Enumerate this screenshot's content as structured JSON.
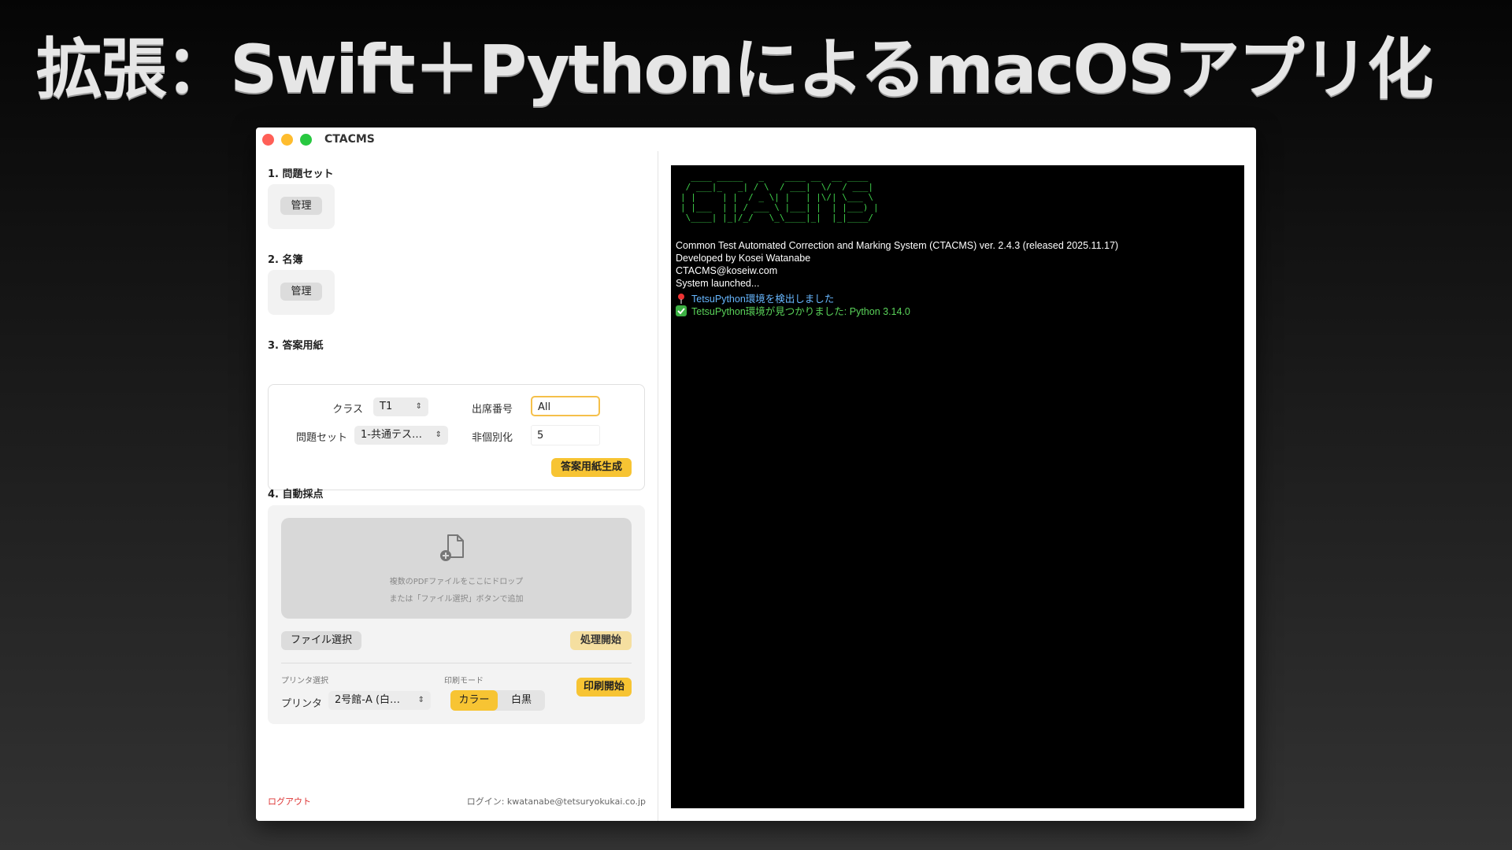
{
  "slide": {
    "title": "拡張：Swift＋PythonによるmacOSアプリ化"
  },
  "window": {
    "title": "CTACMS"
  },
  "section1": {
    "label": "1. 問題セット",
    "manage_button": "管理"
  },
  "section2": {
    "label": "2. 名簿",
    "manage_button": "管理"
  },
  "section3": {
    "label": "3. 答案用紙",
    "class_label": "クラス",
    "class_value": "T1",
    "problemset_label": "問題セット",
    "problemset_value": "1-共通テス…",
    "attendance_label": "出席番号",
    "attendance_value": "All",
    "anonymize_label": "非個別化",
    "anonymize_value": "5",
    "generate_button": "答案用紙生成"
  },
  "section4": {
    "label": "4. 自動採点",
    "drop_line1": "複数のPDFファイルをここにドロップ",
    "drop_line2": "または「ファイル選択」ボタンで追加",
    "file_select_button": "ファイル選択",
    "process_button": "処理開始",
    "printer_section_label": "プリンタ選択",
    "printer_label": "プリンタ",
    "printer_value": "2号館-A (白…",
    "print_mode_label": "印刷モード",
    "mode_color": "カラー",
    "mode_mono": "白黒",
    "print_button": "印刷開始"
  },
  "footer": {
    "logout": "ログアウト",
    "login": "ログイン: kwatanabe@tetsuryokukai.co.jp"
  },
  "terminal": {
    "ascii_art": "  ____ _____   _    ____ __  __ ____\n / ___|_   _| / \\  / ___|  \\/  / ___|\n| |     | |  / _ \\| |   | |\\/| \\___ \\\n| |___  | | / ___ \\ |___| |  | |___) |\n \\____| |_|/_/   \\_\\____|_|  |_|____/",
    "lines": [
      "Common Test Automated Correction and Marking System (CTACMS) ver. 2.4.3 (released 2025.11.17)",
      "Developed by Kosei Watanabe",
      "CTACMS@koseiw.com",
      "System launched..."
    ],
    "status_lines": [
      "TetsuPython環境を検出しました",
      "TetsuPython環境が見つかりました: Python 3.14.0"
    ]
  }
}
